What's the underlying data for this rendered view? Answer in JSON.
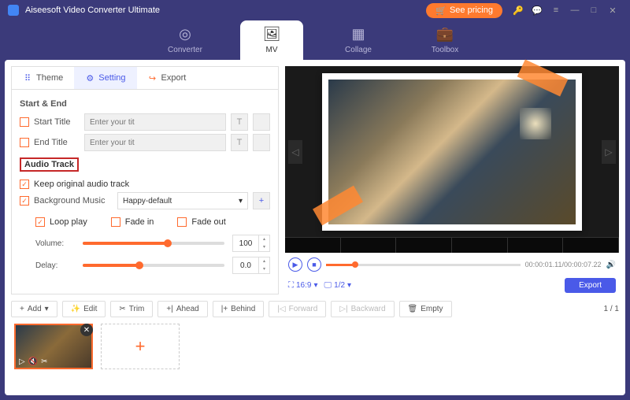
{
  "app": {
    "title": "Aiseesoft Video Converter Ultimate",
    "pricing": "See pricing"
  },
  "nav": {
    "converter": "Converter",
    "mv": "MV",
    "collage": "Collage",
    "toolbox": "Toolbox"
  },
  "tabs": {
    "theme": "Theme",
    "setting": "Setting",
    "export": "Export"
  },
  "section": {
    "startEnd": "Start & End",
    "audioTrack": "Audio Track"
  },
  "fields": {
    "startTitle": "Start Title",
    "endTitle": "End Title",
    "placeholder": "Enter your tit",
    "keepOriginal": "Keep original audio track",
    "bgMusic": "Background Music",
    "bgMusicValue": "Happy-default",
    "loopPlay": "Loop play",
    "fadeIn": "Fade in",
    "fadeOut": "Fade out",
    "volume": "Volume:",
    "volumeValue": "100",
    "delay": "Delay:",
    "delayValue": "0.0"
  },
  "player": {
    "time": "00:00:01.11/00:00:07.22",
    "aspect": "16:9",
    "zoom": "1/2",
    "export": "Export"
  },
  "toolbar": {
    "add": "Add",
    "edit": "Edit",
    "trim": "Trim",
    "ahead": "Ahead",
    "behind": "Behind",
    "forward": "Forward",
    "backward": "Backward",
    "empty": "Empty",
    "page": "1 / 1"
  }
}
